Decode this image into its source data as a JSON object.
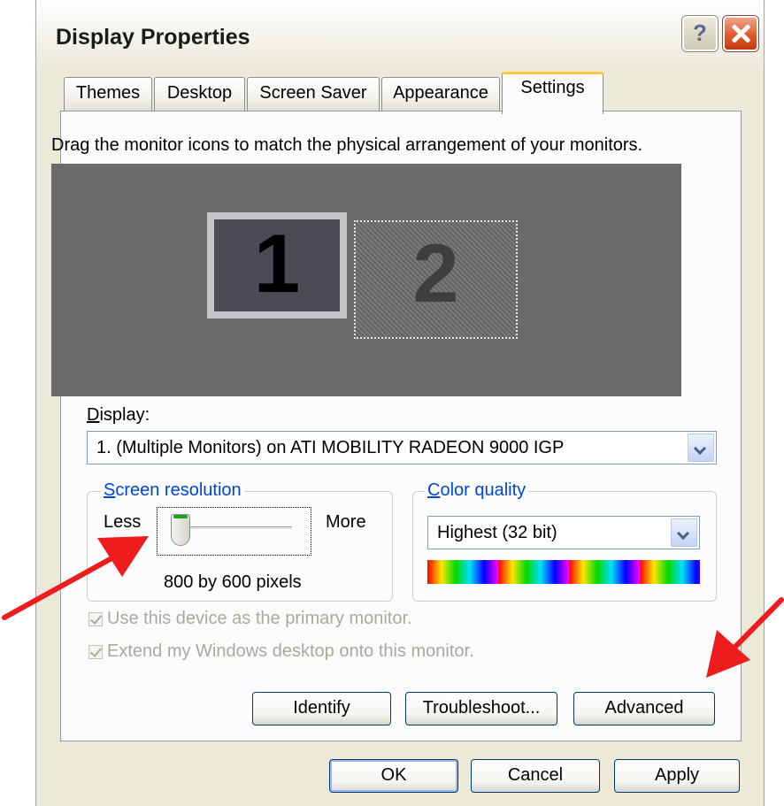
{
  "window": {
    "title": "Display Properties",
    "help_label": "?",
    "close_icon": "close-icon"
  },
  "tabs": [
    {
      "label": "Themes",
      "active": false
    },
    {
      "label": "Desktop",
      "active": false
    },
    {
      "label": "Screen Saver",
      "active": false
    },
    {
      "label": "Appearance",
      "active": false
    },
    {
      "label": "Settings",
      "active": true
    }
  ],
  "settings": {
    "instruction": "Drag the monitor icons to match the physical arrangement of your monitors.",
    "monitors": [
      {
        "number": "1",
        "selected": true
      },
      {
        "number": "2",
        "selected": false
      }
    ],
    "display_label": "Display:",
    "display_value": "1. (Multiple Monitors) on ATI MOBILITY RADEON 9000 IGP",
    "screen_resolution": {
      "legend": "Screen resolution",
      "less_label": "Less",
      "more_label": "More",
      "value_text": "800 by 600 pixels",
      "slider_level": 0.0
    },
    "color_quality": {
      "legend": "Color quality",
      "value": "Highest (32 bit)"
    },
    "checkboxes": [
      {
        "label": "Use this device as the primary monitor.",
        "checked": true,
        "enabled": false
      },
      {
        "label": "Extend my Windows desktop onto this monitor.",
        "checked": true,
        "enabled": false
      }
    ],
    "buttons": {
      "identify": "Identify",
      "troubleshoot": "Troubleshoot...",
      "advanced": "Advanced"
    }
  },
  "footer_buttons": {
    "ok": "OK",
    "cancel": "Cancel",
    "apply": "Apply"
  },
  "colors": {
    "annotation_arrow": "#ee1c1c",
    "legend_text": "#0046d5",
    "tab_highlight": "#ffc83c"
  }
}
